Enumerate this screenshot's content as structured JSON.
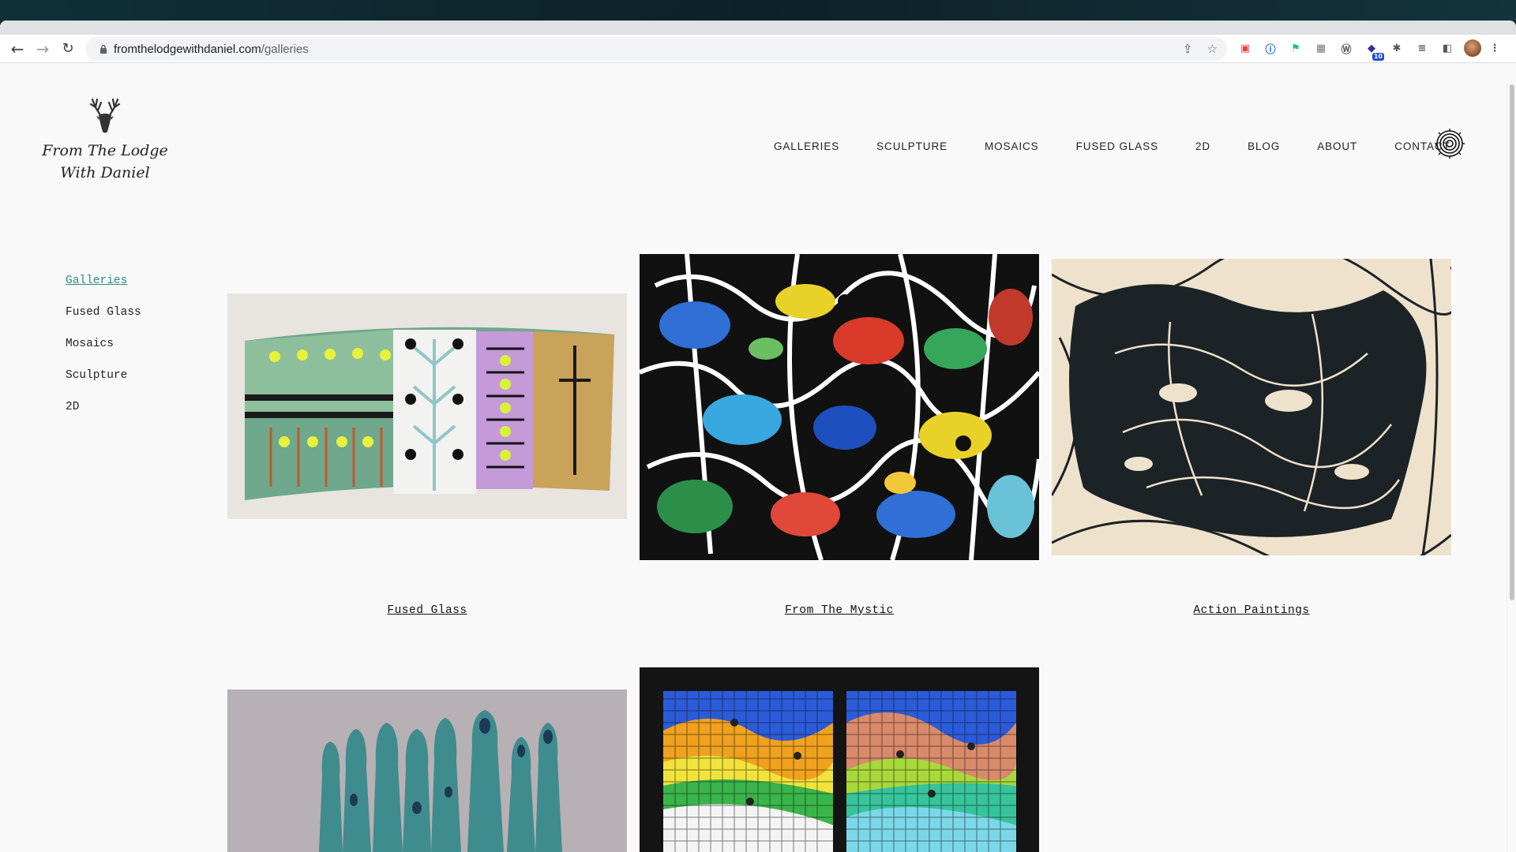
{
  "browser": {
    "url_host": "fromthelodgewithdaniel.com",
    "url_path": "/galleries",
    "extension_badge": "10"
  },
  "site": {
    "logo_line1": "From The Lodge",
    "logo_line2": "With Daniel"
  },
  "main_nav": [
    {
      "label": "GALLERIES"
    },
    {
      "label": "SCULPTURE"
    },
    {
      "label": "MOSAICS"
    },
    {
      "label": "FUSED GLASS"
    },
    {
      "label": "2D"
    },
    {
      "label": "BLOG"
    },
    {
      "label": "ABOUT"
    },
    {
      "label": "CONTACT"
    }
  ],
  "side_nav": [
    {
      "label": "Galleries",
      "active": true
    },
    {
      "label": "Fused Glass",
      "active": false
    },
    {
      "label": "Mosaics",
      "active": false
    },
    {
      "label": "Sculpture",
      "active": false
    },
    {
      "label": "2D",
      "active": false
    }
  ],
  "galleries": [
    {
      "title": "Fused Glass"
    },
    {
      "title": "From The Mystic"
    },
    {
      "title": "Action Paintings"
    },
    {
      "title": ""
    },
    {
      "title": ""
    }
  ],
  "colors": {
    "accent": "#2c8c8c",
    "page_background": "#f9f9f9",
    "text": "#222222"
  }
}
